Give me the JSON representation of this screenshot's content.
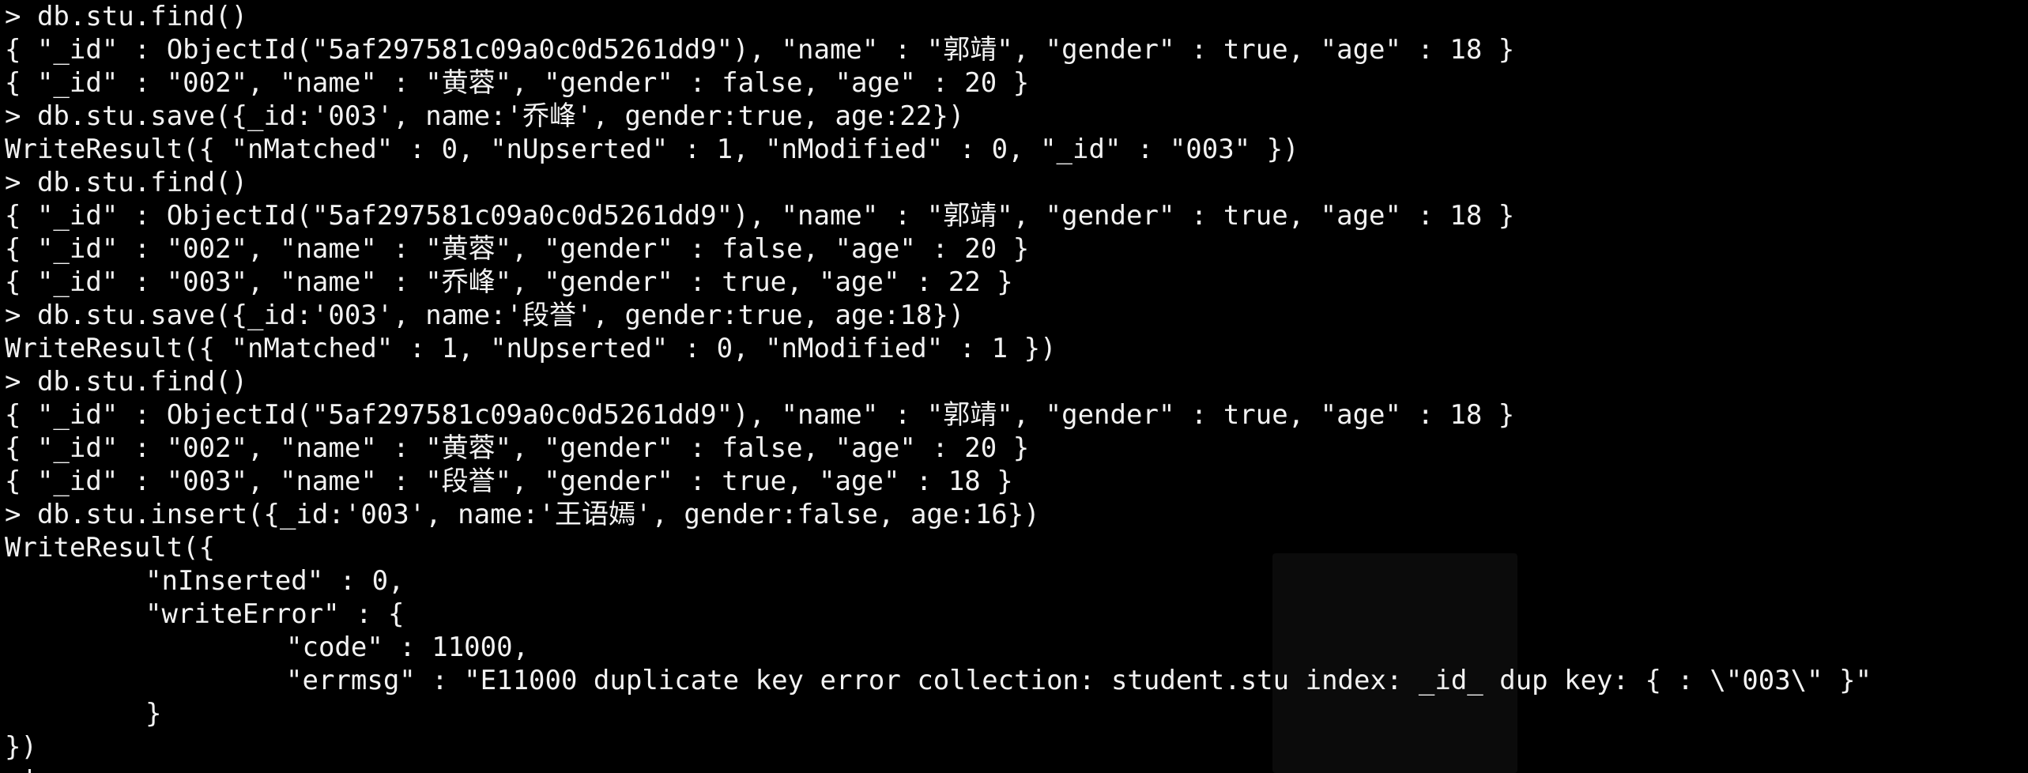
{
  "terminal": {
    "lines": [
      {
        "text": "> db.stu.find()",
        "kind": "command"
      },
      {
        "text": "{ \"_id\" : ObjectId(\"5af297581c09a0c0d5261dd9\"), \"name\" : \"郭靖\", \"gender\" : true, \"age\" : 18 }",
        "kind": "output"
      },
      {
        "text": "{ \"_id\" : \"002\", \"name\" : \"黄蓉\", \"gender\" : false, \"age\" : 20 }",
        "kind": "output"
      },
      {
        "text": "> db.stu.save({_id:'003', name:'乔峰', gender:true, age:22})",
        "kind": "command"
      },
      {
        "text": "WriteResult({ \"nMatched\" : 0, \"nUpserted\" : 1, \"nModified\" : 0, \"_id\" : \"003\" })",
        "kind": "output"
      },
      {
        "text": "> db.stu.find()",
        "kind": "command"
      },
      {
        "text": "{ \"_id\" : ObjectId(\"5af297581c09a0c0d5261dd9\"), \"name\" : \"郭靖\", \"gender\" : true, \"age\" : 18 }",
        "kind": "output"
      },
      {
        "text": "{ \"_id\" : \"002\", \"name\" : \"黄蓉\", \"gender\" : false, \"age\" : 20 }",
        "kind": "output"
      },
      {
        "text": "{ \"_id\" : \"003\", \"name\" : \"乔峰\", \"gender\" : true, \"age\" : 22 }",
        "kind": "output"
      },
      {
        "text": "> db.stu.save({_id:'003', name:'段誉', gender:true, age:18})",
        "kind": "command"
      },
      {
        "text": "WriteResult({ \"nMatched\" : 1, \"nUpserted\" : 0, \"nModified\" : 1 })",
        "kind": "output"
      },
      {
        "text": "> db.stu.find()",
        "kind": "command"
      },
      {
        "text": "{ \"_id\" : ObjectId(\"5af297581c09a0c0d5261dd9\"), \"name\" : \"郭靖\", \"gender\" : true, \"age\" : 18 }",
        "kind": "output"
      },
      {
        "text": "{ \"_id\" : \"002\", \"name\" : \"黄蓉\", \"gender\" : false, \"age\" : 20 }",
        "kind": "output"
      },
      {
        "text": "{ \"_id\" : \"003\", \"name\" : \"段誉\", \"gender\" : true, \"age\" : 18 }",
        "kind": "output"
      },
      {
        "text": "> db.stu.insert({_id:'003', name:'王语嫣', gender:false, age:16})",
        "kind": "command"
      },
      {
        "text": "WriteResult({",
        "kind": "output"
      },
      {
        "text": "\"nInserted\" : 0,",
        "kind": "output",
        "indent": 1
      },
      {
        "text": "\"writeError\" : {",
        "kind": "output",
        "indent": 1
      },
      {
        "text": "\"code\" : 11000,",
        "kind": "output",
        "indent": 2
      },
      {
        "text": "\"errmsg\" : \"E11000 duplicate key error collection: student.stu index: _id_ dup key: { : \\\"003\\\" }\"",
        "kind": "output",
        "indent": 2
      },
      {
        "text": "}",
        "kind": "output",
        "indent": 1
      },
      {
        "text": "})",
        "kind": "output"
      }
    ],
    "prompt": ">",
    "colors": {
      "background": "#000000",
      "foreground": "#f2f2f2"
    }
  }
}
